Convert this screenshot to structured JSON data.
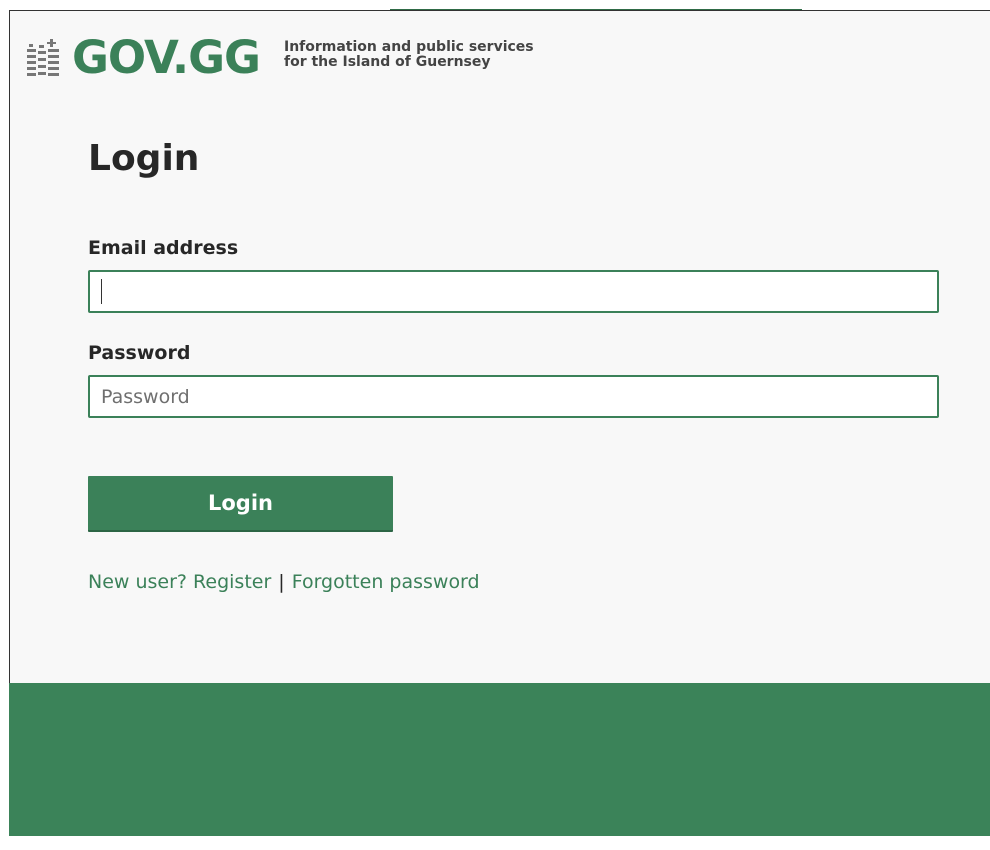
{
  "header": {
    "logo_text": "GOV.GG",
    "tagline_line1": "Information and public services",
    "tagline_line2": "for the Island of Guernsey",
    "crest_icon": "guernsey-crest-icon"
  },
  "page": {
    "title": "Login"
  },
  "form": {
    "email": {
      "label": "Email address",
      "value": "",
      "placeholder": ""
    },
    "password": {
      "label": "Password",
      "value": "",
      "placeholder": "Password"
    },
    "submit_label": "Login"
  },
  "links": {
    "register_label": "New user? Register",
    "separator": "|",
    "forgot_label": "Forgotten password"
  },
  "colors": {
    "brand_green": "#3b8159",
    "footer_green": "#3b8359",
    "text_dark": "#272727",
    "background": "#f8f8f8"
  }
}
